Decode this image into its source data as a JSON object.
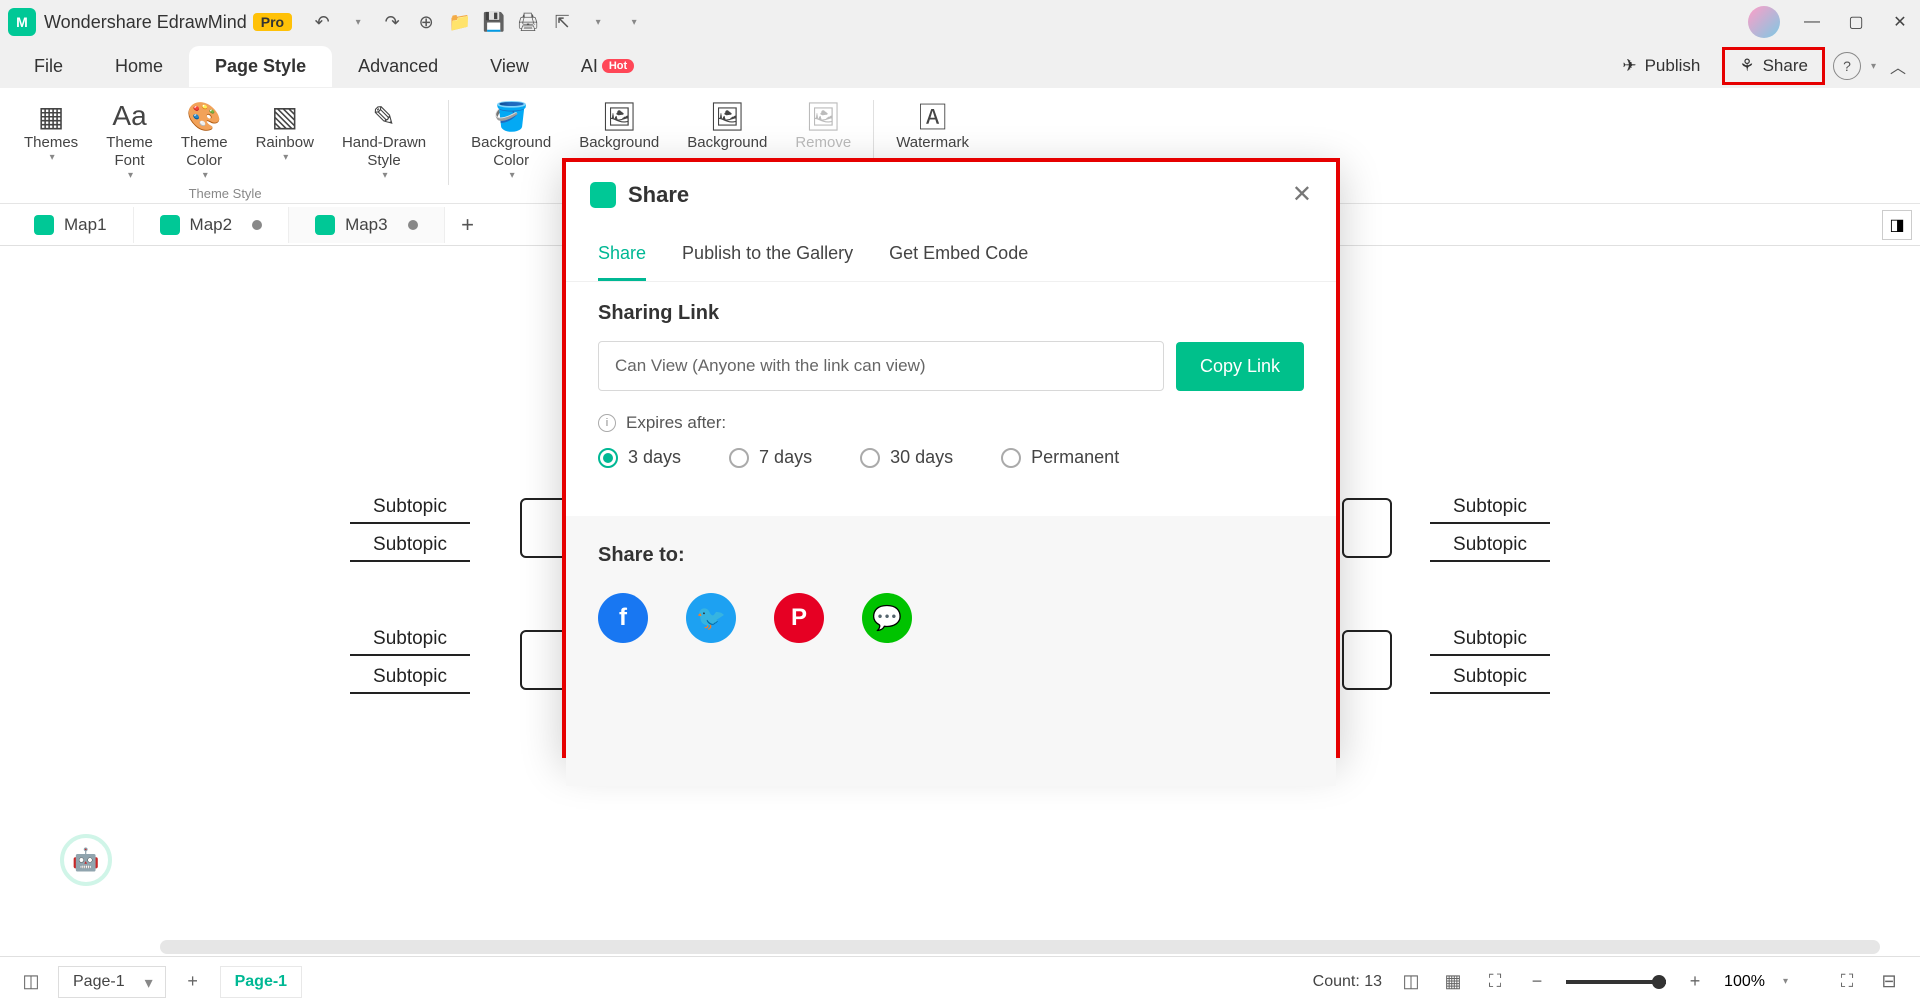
{
  "titlebar": {
    "app_name": "Wondershare EdrawMind",
    "pro_badge": "Pro"
  },
  "menu": {
    "file": "File",
    "home": "Home",
    "page_style": "Page Style",
    "advanced": "Advanced",
    "view": "View",
    "ai": "AI",
    "hot": "Hot",
    "publish": "Publish",
    "share": "Share"
  },
  "ribbon": {
    "themes": "Themes",
    "theme_font": "Theme\nFont",
    "theme_color": "Theme\nColor",
    "rainbow": "Rainbow",
    "hand_drawn": "Hand-Drawn\nStyle",
    "group_theme_style": "Theme Style",
    "bg_color": "Background\nColor",
    "bg1": "Background",
    "bg2": "Background",
    "remove": "Remove",
    "watermark": "Watermark"
  },
  "tabs": {
    "map1": "Map1",
    "map2": "Map2",
    "map3": "Map3"
  },
  "canvas": {
    "subtopic": "Subtopic"
  },
  "dialog": {
    "title": "Share",
    "tab_share": "Share",
    "tab_gallery": "Publish to the Gallery",
    "tab_embed": "Get Embed Code",
    "sharing_link": "Sharing Link",
    "link_text": "Can View (Anyone with the link can view)",
    "copy_link": "Copy Link",
    "expires_after": "Expires after:",
    "opt_3days": "3 days",
    "opt_7days": "7 days",
    "opt_30days": "30 days",
    "opt_permanent": "Permanent",
    "share_to": "Share to:"
  },
  "status": {
    "page_selector": "Page-1",
    "active_page": "Page-1",
    "count": "Count: 13",
    "zoom": "100%"
  }
}
